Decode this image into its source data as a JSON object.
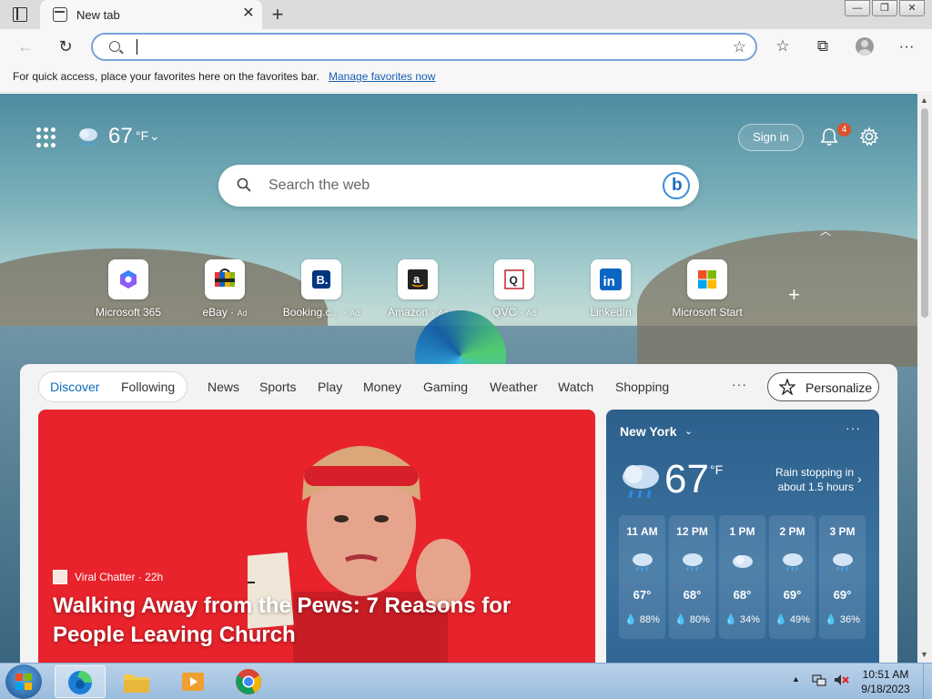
{
  "browser": {
    "tab_title": "New tab",
    "tab_close": "✕",
    "new_tab": "+",
    "address_value": "",
    "window_controls": [
      "—",
      "❐",
      "✕"
    ],
    "favbar_text": "For quick access, place your favorites here on the favorites bar.",
    "favbar_link": "Manage favorites now"
  },
  "header": {
    "temperature": "67",
    "unit": "°F",
    "signin_label": "Sign in",
    "notification_count": "4"
  },
  "search": {
    "placeholder": "Search the web"
  },
  "tiles": [
    {
      "label": "Microsoft 365",
      "ad": ""
    },
    {
      "label": "eBay",
      "ad": "Ad"
    },
    {
      "label": "Booking.c...",
      "ad": "Ad"
    },
    {
      "label": "Amazon",
      "ad": "Ad"
    },
    {
      "label": "QVC",
      "ad": "Ad"
    },
    {
      "label": "LinkedIn",
      "ad": ""
    },
    {
      "label": "Microsoft Start",
      "ad": ""
    }
  ],
  "feed": {
    "tabs": [
      "Discover",
      "Following",
      "News",
      "Sports",
      "Play",
      "Money",
      "Gaming",
      "Weather",
      "Watch",
      "Shopping"
    ],
    "more": "···",
    "personalize_label": "Personalize",
    "hero": {
      "source": "Viral Chatter · 22h",
      "title": "Walking Away from the Pews: 7 Reasons for People Leaving Church"
    }
  },
  "weather_card": {
    "city": "New York",
    "more": "···",
    "temperature": "67",
    "unit": "°F",
    "summary": "Rain stopping in about 1.5 hours",
    "hours": [
      {
        "time": "11 AM",
        "temp": "67°",
        "rain": "88%",
        "icon": "rain-cloud-icon"
      },
      {
        "time": "12 PM",
        "temp": "68°",
        "rain": "80%",
        "icon": "rain-cloud-icon"
      },
      {
        "time": "1 PM",
        "temp": "68°",
        "rain": "34%",
        "icon": "cloud-icon"
      },
      {
        "time": "2 PM",
        "temp": "69°",
        "rain": "49%",
        "icon": "rain-cloud-icon"
      },
      {
        "time": "3 PM",
        "temp": "69°",
        "rain": "36%",
        "icon": "rain-cloud-icon"
      }
    ]
  },
  "taskbar": {
    "time": "10:51 AM",
    "date": "9/18/2023"
  },
  "colors": {
    "accent": "#0f6cbd",
    "hero_bg": "#e8232b",
    "notification_badge": "#d9532c"
  }
}
